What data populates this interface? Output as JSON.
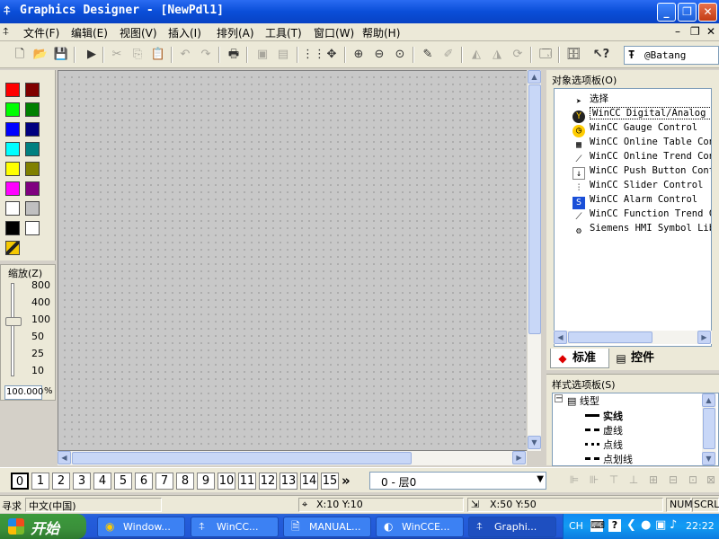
{
  "window": {
    "title": "Graphics Designer - [NewPdl1]"
  },
  "menu": [
    "文件(F)",
    "编辑(E)",
    "视图(V)",
    "插入(I)",
    "排列(A)",
    "工具(T)",
    "窗口(W)",
    "帮助(H)"
  ],
  "toolbar": {
    "font_name": "@Batang"
  },
  "colors": [
    "#ff0000",
    "#800000",
    "#00ff00",
    "#008000",
    "#0000ff",
    "#000080",
    "#00ffff",
    "#008080",
    "#ffff00",
    "#808000",
    "#ff00ff",
    "#800080",
    "#ffffff",
    "#c0c0c0",
    "#000000",
    "#ffffff"
  ],
  "zoom": {
    "title": "缩放(Z)",
    "ticks": [
      "800",
      "400",
      "100",
      "50",
      "25",
      "10"
    ],
    "value": "100.000",
    "unit": "%"
  },
  "object_palette": {
    "title": "对象选项板(O)",
    "items": [
      {
        "label": "选择",
        "icon": "pointer-icon"
      },
      {
        "label": "WinCC Digital/Analog Clo",
        "icon": "clock-icon"
      },
      {
        "label": "WinCC Gauge Control",
        "icon": "gauge-icon"
      },
      {
        "label": "WinCC Online Table Con",
        "icon": "table-icon"
      },
      {
        "label": "WinCC Online Trend Con",
        "icon": "trend-icon"
      },
      {
        "label": "WinCC Push Button Cont",
        "icon": "push-button-icon"
      },
      {
        "label": "WinCC Slider Control",
        "icon": "slider-icon"
      },
      {
        "label": "WinCC Alarm Control",
        "icon": "alarm-icon"
      },
      {
        "label": "WinCC Function Trend C",
        "icon": "function-trend-icon"
      },
      {
        "label": "Siemens HMI Symbol Lib",
        "icon": "symbol-library-icon"
      }
    ],
    "tabs": [
      "标准",
      "控件"
    ]
  },
  "style_palette": {
    "title": "样式选项板(S)",
    "root": "线型",
    "items": [
      "实线",
      "虚线",
      "点线",
      "点划线"
    ]
  },
  "layers": {
    "buttons": [
      "0",
      "1",
      "2",
      "3",
      "4",
      "5",
      "6",
      "7",
      "8",
      "9",
      "10",
      "11",
      "12",
      "13",
      "14",
      "15"
    ],
    "more": "»",
    "selected": "0 - 层0"
  },
  "status": {
    "hint": "寻求",
    "language": "中文(中国)",
    "cursor": "X:10 Y:10",
    "size": "X:50 Y:50",
    "num": "NUM",
    "scrl": "SCRL"
  },
  "taskbar": {
    "start": "开始",
    "tasks": [
      "Window...",
      "WinCC...",
      "MANUAL...",
      "WinCCE...",
      "Graphi..."
    ],
    "lang": "CH",
    "clock": "22:22"
  }
}
